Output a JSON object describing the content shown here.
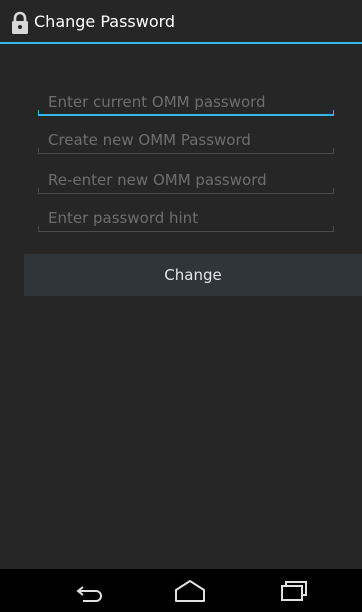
{
  "dialog": {
    "title": "Change Password",
    "title_icon": "lock-icon"
  },
  "form": {
    "fields": [
      {
        "placeholder": "Enter current OMM password",
        "focused": true
      },
      {
        "placeholder": "Create new OMM Password",
        "focused": false
      },
      {
        "placeholder": "Re-enter new OMM password",
        "focused": false
      },
      {
        "placeholder": "Enter password hint",
        "focused": false
      }
    ],
    "submit_label": "Change"
  },
  "nav_bar": {
    "buttons": [
      "back-icon",
      "home-icon",
      "recent-apps-icon"
    ]
  },
  "colors": {
    "accent": "#33b5e5",
    "dialog_background": "#262626",
    "button_background": "#30353a",
    "screen_background": "#000000"
  }
}
